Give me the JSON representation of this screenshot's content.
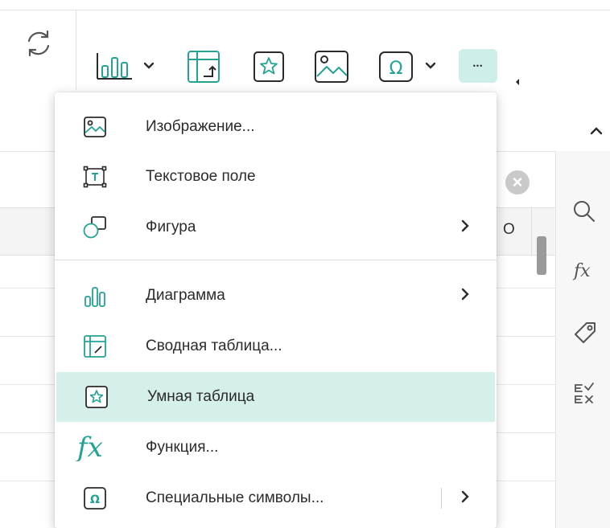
{
  "toolbar": {
    "buttons": [
      {
        "name": "refresh-icon"
      },
      {
        "name": "chart-icon",
        "has_dropdown": true
      },
      {
        "name": "pivot-table-icon"
      },
      {
        "name": "smart-table-icon"
      },
      {
        "name": "image-icon"
      },
      {
        "name": "special-symbol-icon",
        "has_dropdown": true
      },
      {
        "name": "more-icon",
        "active": true
      }
    ],
    "accent_color": "#24a394",
    "active_bg": "#cdeee9"
  },
  "sheet": {
    "column_header_visible": "O"
  },
  "side_panel": {
    "icons": [
      "search-icon",
      "function-icon",
      "tag-icon",
      "check-list-icon"
    ]
  },
  "menu": {
    "items": [
      {
        "label": "Изображение...",
        "icon": "image-icon",
        "submenu": false
      },
      {
        "label": "Текстовое поле",
        "icon": "text-field-icon",
        "submenu": false
      },
      {
        "label": "Фигура",
        "icon": "shape-icon",
        "submenu": true
      },
      {
        "label": "Диаграмма",
        "icon": "chart-icon",
        "submenu": true
      },
      {
        "label": "Сводная таблица...",
        "icon": "pivot-table-icon",
        "submenu": false
      },
      {
        "label": "Умная таблица",
        "icon": "smart-table-icon",
        "submenu": false,
        "highlighted": true
      },
      {
        "label": "Функция...",
        "icon": "function-icon",
        "submenu": false
      },
      {
        "label": "Специальные символы...",
        "icon": "special-symbol-icon",
        "submenu": true
      }
    ],
    "chevron": "›",
    "highlight_color": "#d5efeb"
  },
  "glyphs": {
    "collapse": "⌃",
    "dots": "•••",
    "clear": "×"
  }
}
